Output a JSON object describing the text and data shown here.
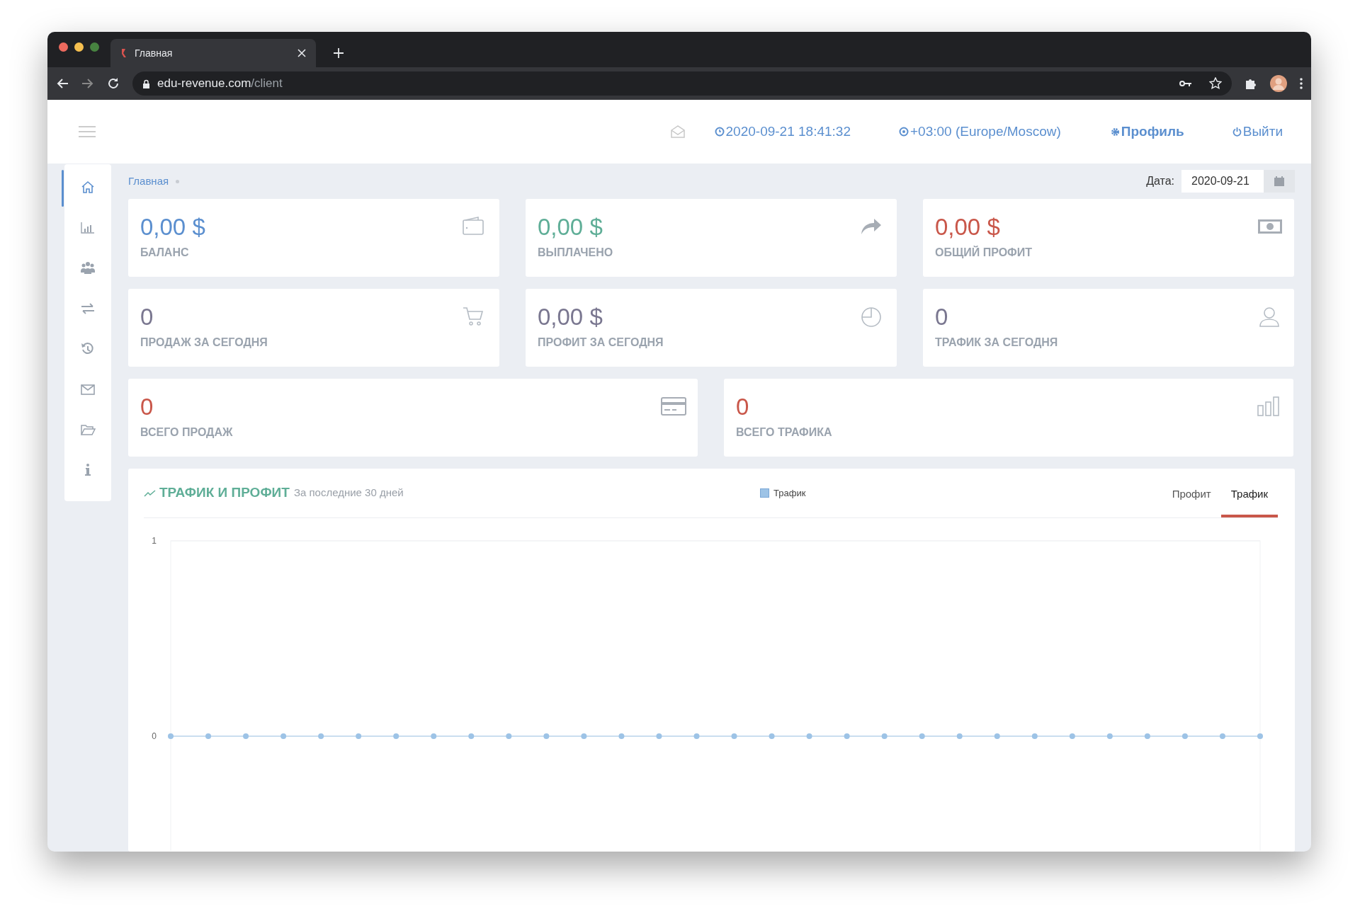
{
  "browser": {
    "tab_title": "Главная",
    "url_host": "edu-revenue.com",
    "url_path": "/client"
  },
  "header": {
    "datetime": "2020-09-21 18:41:32",
    "timezone": "+03:00 (Europe/Moscow)",
    "profile": "Профиль",
    "logout": "Выйти"
  },
  "sidebar": {
    "items": [
      {
        "selected": true
      },
      {
        "selected": false
      },
      {
        "selected": false
      },
      {
        "selected": false
      },
      {
        "selected": false
      },
      {
        "selected": false
      },
      {
        "selected": false
      },
      {
        "selected": false
      }
    ]
  },
  "breadcrumb": [
    "Главная"
  ],
  "date_filter": {
    "label": "Дата:",
    "value": "2020-09-21"
  },
  "cards": [
    {
      "value": "0,00 $",
      "label": "БАЛАНС",
      "color": "#5b8fcf"
    },
    {
      "value": "0,00 $",
      "label": "ВЫПЛАЧЕНО",
      "color": "#5fae97"
    },
    {
      "value": "0,00 $",
      "label": "ОБЩИЙ ПРОФИТ",
      "color": "#c9574a"
    },
    {
      "value": "0",
      "label": "ПРОДАЖ ЗА СЕГОДНЯ",
      "color": "#7a7790"
    },
    {
      "value": "0,00 $",
      "label": "ПРОФИТ ЗА СЕГОДНЯ",
      "color": "#7a7790"
    },
    {
      "value": "0",
      "label": "ТРАФИК ЗА СЕГОДНЯ",
      "color": "#7a7790"
    },
    {
      "value": "0",
      "label": "ВСЕГО ПРОДАЖ",
      "color": "#c9574a"
    },
    {
      "value": "0",
      "label": "ВСЕГО ТРАФИКА",
      "color": "#c9574a"
    }
  ],
  "chart_panel": {
    "title": "ТРАФИК И ПРОФИТ",
    "subtitle": "За последние 30 дней",
    "tabs": [
      {
        "label": "Профит",
        "selected": false
      },
      {
        "label": "Трафик",
        "selected": true
      }
    ],
    "chart_data": {
      "type": "line",
      "categories": [
        null,
        null,
        null,
        null,
        null,
        null,
        null,
        null,
        null,
        null,
        null,
        null,
        null,
        null,
        null,
        null,
        null,
        null,
        null,
        null,
        null,
        null,
        null,
        null,
        null,
        null,
        null,
        null,
        null,
        null
      ],
      "ylim": [
        -0.6,
        1
      ],
      "yticks": [
        0,
        1
      ],
      "series": [
        {
          "name": "Трафик",
          "color": "#9dc3e6",
          "marker": "circle",
          "values": [
            0,
            0,
            0,
            0,
            0,
            0,
            0,
            0,
            0,
            0,
            0,
            0,
            0,
            0,
            0,
            0,
            0,
            0,
            0,
            0,
            0,
            0,
            0,
            0,
            0,
            0,
            0,
            0,
            0,
            0
          ]
        }
      ]
    }
  }
}
